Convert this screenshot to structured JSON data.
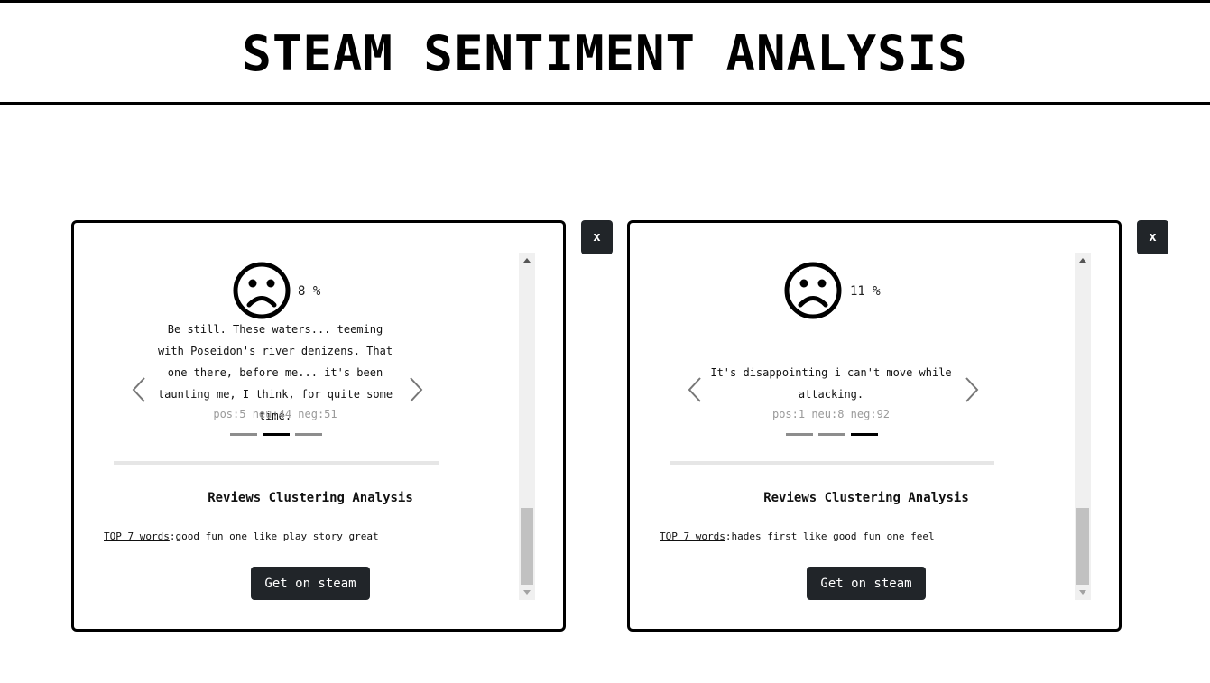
{
  "header": {
    "title": "STEAM SENTIMENT ANALYSIS"
  },
  "cards": [
    {
      "close_label": "x",
      "sentiment_icon": "frown-face-icon",
      "sentiment_percent": "8 %",
      "review_text": "Be still. These waters... teeming with Poseidon's river denizens. That one there, before me... it's been taunting me, I think, for quite some time.",
      "scores": "pos:5 neu:44 neg:51",
      "carousel_active_index": 1,
      "carousel_count": 3,
      "cluster_title": "Reviews Clustering Analysis",
      "top_words_label": "TOP 7 words",
      "top_words_value": ":good fun one like play story great",
      "steam_button_label": "Get on steam"
    },
    {
      "close_label": "x",
      "sentiment_icon": "frown-face-icon",
      "sentiment_percent": "11 %",
      "review_text": "It's disappointing i can't move while attacking.",
      "scores": "pos:1 neu:8 neg:92",
      "carousel_active_index": 2,
      "carousel_count": 3,
      "cluster_title": "Reviews Clustering Analysis",
      "top_words_label": "TOP 7 words",
      "top_words_value": ":hades first like good fun one feel",
      "steam_button_label": "Get on steam"
    }
  ]
}
